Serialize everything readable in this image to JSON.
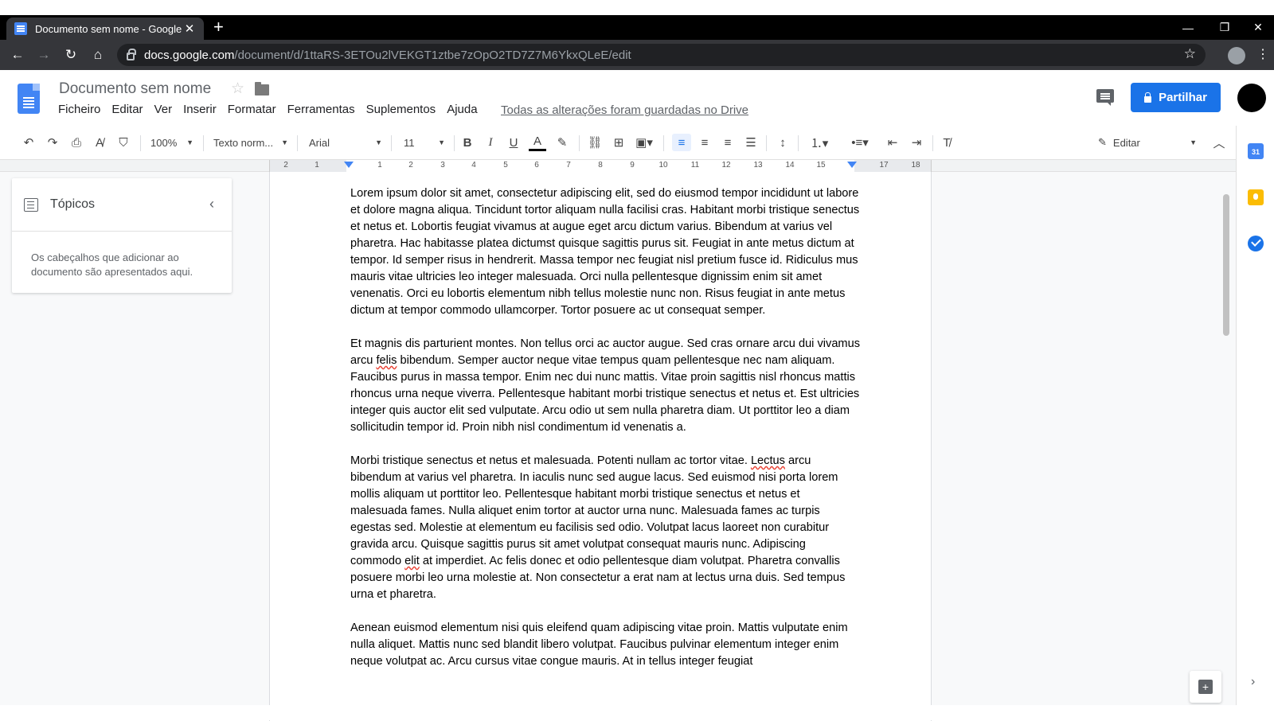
{
  "browser": {
    "tab_title": "Documento sem nome - Google",
    "url_host": "docs.google.com",
    "url_path": "/document/d/1ttaRS-3ETOu2lVEKGT1ztbe7zOpO2TD7Z7M6YkxQLeE/edit"
  },
  "doc": {
    "title": "Documento sem nome",
    "menu": [
      "Ficheiro",
      "Editar",
      "Ver",
      "Inserir",
      "Formatar",
      "Ferramentas",
      "Suplementos",
      "Ajuda"
    ],
    "saved_status": "Todas as alterações foram guardadas no Drive",
    "share_label": "Partilhar"
  },
  "toolbar": {
    "zoom": "100%",
    "style": "Texto norm...",
    "font": "Arial",
    "size": "11",
    "mode": "Editar"
  },
  "ruler": {
    "numbers": [
      "2",
      "1",
      "1",
      "2",
      "3",
      "4",
      "5",
      "6",
      "7",
      "8",
      "9",
      "10",
      "11",
      "12",
      "13",
      "14",
      "15",
      "17",
      "18"
    ]
  },
  "outline": {
    "title": "Tópicos",
    "empty_text": "Os cabeçalhos que adicionar ao documento são apresentados aqui."
  },
  "content": {
    "p1": "Lorem ipsum dolor sit amet, consectetur adipiscing elit, sed do eiusmod tempor incididunt ut labore et dolore magna aliqua. Tincidunt tortor aliquam nulla facilisi cras. Habitant morbi tristique senectus et netus et. Lobortis feugiat vivamus at augue eget arcu dictum varius. Bibendum at varius vel pharetra. Hac habitasse platea dictumst quisque sagittis purus sit. Feugiat in ante metus dictum at tempor. Id semper risus in hendrerit. Massa tempor nec feugiat nisl pretium fusce id. Ridiculus mus mauris vitae ultricies leo integer malesuada. Orci nulla pellentesque dignissim enim sit amet venenatis. Orci eu lobortis elementum nibh tellus molestie nunc non. Risus feugiat in ante metus dictum at tempor commodo ullamcorper. Tortor posuere ac ut consequat semper.",
    "p2_a": "Et magnis dis parturient montes. Non tellus orci ac auctor augue. Sed cras ornare arcu dui vivamus arcu ",
    "p2_sq": "felis",
    "p2_b": " bibendum. Semper auctor neque vitae tempus quam pellentesque nec nam aliquam. Faucibus purus in massa tempor. Enim nec dui nunc mattis. Vitae proin sagittis nisl rhoncus mattis rhoncus urna neque viverra. Pellentesque habitant morbi tristique senectus et netus et. Est ultricies integer quis auctor elit sed vulputate. Arcu odio ut sem nulla pharetra diam. Ut porttitor leo a diam sollicitudin tempor id. Proin nibh nisl condimentum id venenatis a.",
    "p3_a": "Morbi tristique senectus et netus et malesuada. Potenti nullam ac tortor vitae. ",
    "p3_sq1": "Lectus",
    "p3_b": " arcu bibendum at varius vel pharetra. In iaculis nunc sed augue lacus. Sed euismod nisi porta lorem mollis aliquam ut porttitor leo. Pellentesque habitant morbi tristique senectus et netus et malesuada fames. Nulla aliquet enim tortor at auctor urna nunc. Malesuada fames ac turpis egestas sed. Molestie at elementum eu facilisis sed odio. Volutpat lacus laoreet non curabitur gravida arcu. Quisque sagittis purus sit amet volutpat consequat mauris nunc. Adipiscing commodo ",
    "p3_sq2": "elit",
    "p3_c": " at imperdiet. Ac felis donec et odio pellentesque diam volutpat. Pharetra convallis posuere morbi leo urna molestie at. Non consectetur a erat nam at lectus urna duis. Sed tempus urna et pharetra.",
    "p4": "Aenean euismod elementum nisi quis eleifend quam adipiscing vitae proin. Mattis vulputate enim nulla aliquet. Mattis nunc sed blandit libero volutpat. Faucibus pulvinar elementum integer enim neque volutpat ac. Arcu cursus vitae congue mauris. At in tellus integer feugiat"
  },
  "sidepanel": {
    "calendar_day": "31"
  }
}
